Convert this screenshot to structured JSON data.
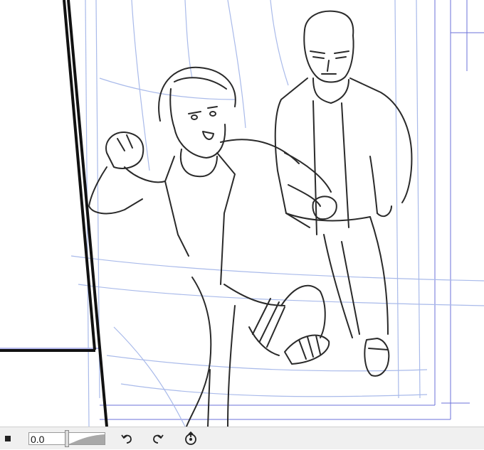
{
  "canvas": {
    "description_icon": "sketch-canvas",
    "line_color": "#2a2a2a",
    "guide_color": "#6b72d8",
    "sketch_color": "#9fb2e8"
  },
  "toolbar": {
    "stop_icon": "stop-icon",
    "rotation_value": "0.0",
    "undo_icon": "undo-icon",
    "redo_icon": "redo-icon",
    "reset_icon": "reset-rotation-icon",
    "background": "#f0f0f0"
  }
}
